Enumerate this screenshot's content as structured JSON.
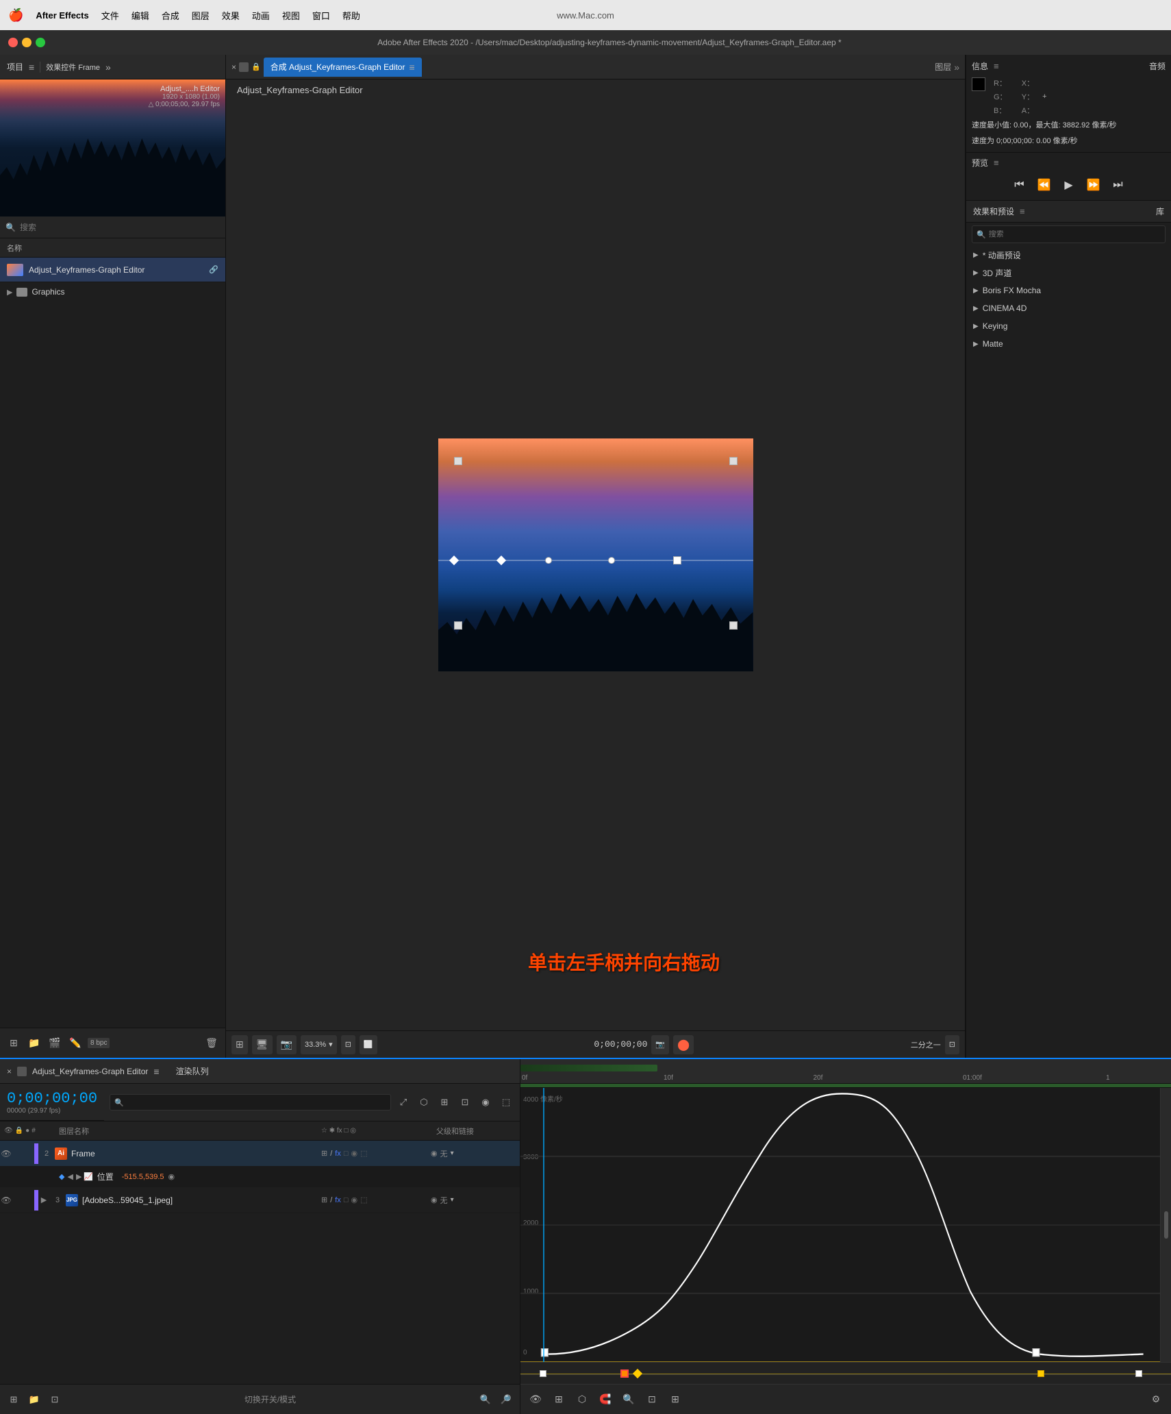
{
  "menubar": {
    "apple": "🍎",
    "app_name": "After Effects",
    "items": [
      "文件",
      "编辑",
      "合成",
      "图层",
      "效果",
      "动画",
      "视图",
      "窗口",
      "帮助"
    ],
    "watermark": "www.Mac.com"
  },
  "titlebar": {
    "title": "Adobe After Effects 2020 - /Users/mac/Desktop/adjusting-keyframes-dynamic-movement/Adjust_Keyframes-Graph_Editor.aep *"
  },
  "project_panel": {
    "title": "项目",
    "menu_icon": "≡",
    "effect_controls": "效果控件 Frame",
    "expand_icon": "»",
    "thumbnail": {
      "filename": "Adjust_....h Editor",
      "resolution": "1920 x 1080 (1.00)",
      "duration": "△ 0;00;05;00, 29.97 fps"
    },
    "search_placeholder": "搜索",
    "columns": {
      "name": "名称"
    },
    "items": [
      {
        "name": "Adjust_Keyframes-Graph Editor",
        "type": "composition"
      },
      {
        "name": "Graphics",
        "type": "folder"
      }
    ],
    "bottom_icons": [
      "new-item",
      "folder",
      "composition",
      "paint",
      "trash"
    ],
    "bpc": "8 bpc"
  },
  "composition": {
    "tab_label": "合成 Adjust_Keyframes-Graph Editor",
    "layers_tab": "图层",
    "close": "×",
    "title": "Adjust_Keyframes-Graph Editor",
    "viewer": {
      "zoom": "33.3%",
      "timecode": "0;00;00;00",
      "camera_icon": "📷",
      "quality": "二分之一"
    }
  },
  "info_panel": {
    "title": "信息",
    "audio_tab": "音频",
    "color": {
      "R": "R：",
      "G": "G：",
      "B": "B：",
      "A": "A："
    },
    "position": {
      "X": "X：",
      "Y": "Y："
    },
    "plus": "+",
    "speed_info": "速度最小值: 0.00，最大值: 3882.92 像素/秒",
    "speed_current": "速度为 0;00;00;00: 0.00 像素/秒"
  },
  "preview_panel": {
    "title": "预览",
    "menu_icon": "≡",
    "buttons": [
      "⏮",
      "⏪",
      "▶",
      "⏩",
      "⏭"
    ]
  },
  "effects_panel": {
    "title": "效果和预设",
    "menu_icon": "≡",
    "library_tab": "库",
    "search_placeholder": "搜索",
    "items": [
      "* 动画预设",
      "3D 声道",
      "Boris FX Mocha",
      "CINEMA 4D",
      "Keying",
      "Matte"
    ]
  },
  "timeline": {
    "close": "×",
    "tab_label": "Adjust_Keyframes-Graph Editor",
    "menu_icon": "≡",
    "render_queue": "渲染队列",
    "timecode": "0;00;00;00",
    "fps_label": "00000 (29.97 fps)",
    "columns": {
      "layer_name": "图层名称",
      "switches": "☆ ✱ fx □ ◎ ○ ≡",
      "parent": "父级和链接"
    },
    "layers": [
      {
        "number": "2",
        "name": "Frame",
        "type": "ai",
        "has_keyframes": true,
        "switches": "fx",
        "parent": "无",
        "sub_rows": [
          {
            "label": "位置",
            "value": "-515.5,539.5"
          }
        ]
      },
      {
        "number": "3",
        "name": "[AdobeS...59045_1.jpeg]",
        "type": "jpg",
        "has_keyframes": false,
        "switches": "fx",
        "parent": "无"
      }
    ],
    "bottom_label": "切换开关/模式"
  },
  "graph_editor": {
    "y_labels": [
      "4000 像素/秒",
      "3000",
      "2000",
      "1000",
      "0"
    ],
    "ruler_labels": [
      "0f",
      "10f",
      "20f",
      "01:00f",
      "1"
    ],
    "annotation": "单击左手柄并向右拖动"
  }
}
